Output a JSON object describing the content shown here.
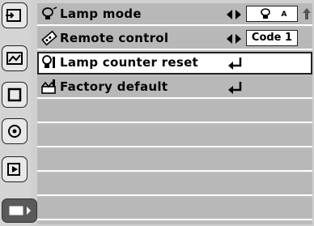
{
  "sidebar": {
    "items": [
      {
        "icon": "input-icon"
      },
      {
        "icon": "image-icon"
      },
      {
        "icon": "screen-icon"
      },
      {
        "icon": "color-icon"
      },
      {
        "icon": "setting-icon"
      },
      {
        "icon": "info-icon"
      }
    ]
  },
  "menu": {
    "rows": [
      {
        "label": "Lamp mode",
        "value": "",
        "control": "left-right-arrows",
        "value_icon": "lamp-icon"
      },
      {
        "label": "Remote control",
        "value": "Code 1",
        "control": "left-right-arrows"
      },
      {
        "label": "Lamp counter reset",
        "control": "enter-icon"
      },
      {
        "label": "Factory default",
        "control": "enter-icon"
      }
    ],
    "lamp_value_subscript": "A"
  },
  "colors": {
    "selected_row_bg": "#ffffff",
    "row_bg": "#b8b8b8",
    "sidebar_active": "#5a5a5a"
  }
}
